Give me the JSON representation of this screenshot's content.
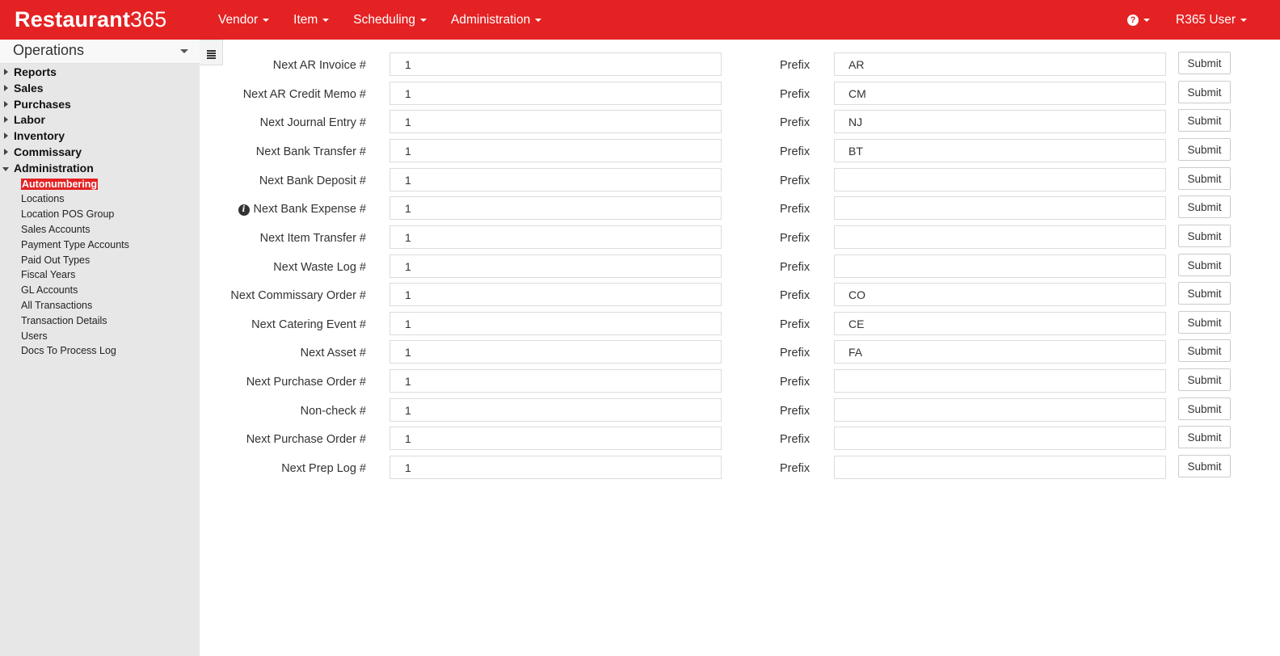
{
  "app": {
    "logo_bold": "Restaurant",
    "logo_thin": "365"
  },
  "nav": {
    "items": [
      {
        "label": "Vendor"
      },
      {
        "label": "Item"
      },
      {
        "label": "Scheduling"
      },
      {
        "label": "Administration"
      }
    ],
    "help_icon": "question-circle-icon",
    "user_label": "R365 User"
  },
  "colors": {
    "brand": "#e42223",
    "sidebar_bg": "#e7e7e7"
  },
  "sidebar": {
    "title": "Operations",
    "groups": [
      {
        "label": "Reports",
        "expanded": false
      },
      {
        "label": "Sales",
        "expanded": false
      },
      {
        "label": "Purchases",
        "expanded": false
      },
      {
        "label": "Labor",
        "expanded": false
      },
      {
        "label": "Inventory",
        "expanded": false
      },
      {
        "label": "Commissary",
        "expanded": false
      },
      {
        "label": "Administration",
        "expanded": true
      }
    ],
    "admin_items": [
      {
        "label": "Autonumbering",
        "active": true
      },
      {
        "label": "Locations"
      },
      {
        "label": "Location POS Group"
      },
      {
        "label": "Sales Accounts"
      },
      {
        "label": "Payment Type Accounts"
      },
      {
        "label": "Paid Out Types"
      },
      {
        "label": "Fiscal Years"
      },
      {
        "label": "GL Accounts"
      },
      {
        "label": "All Transactions"
      },
      {
        "label": "Transaction Details"
      },
      {
        "label": "Users"
      },
      {
        "label": "Docs To Process Log"
      }
    ]
  },
  "form": {
    "prefix_label": "Prefix",
    "submit_label": "Submit",
    "rows": [
      {
        "label": "Next AR Invoice #",
        "value": "1",
        "prefix": "AR"
      },
      {
        "label": "Next AR Credit Memo #",
        "value": "1",
        "prefix": "CM"
      },
      {
        "label": "Next Journal Entry #",
        "value": "1",
        "prefix": "NJ"
      },
      {
        "label": "Next Bank Transfer #",
        "value": "1",
        "prefix": "BT"
      },
      {
        "label": "Next Bank Deposit #",
        "value": "1",
        "prefix": ""
      },
      {
        "label": "Next Bank Expense #",
        "value": "1",
        "prefix": "",
        "info": true
      },
      {
        "label": "Next Item Transfer #",
        "value": "1",
        "prefix": ""
      },
      {
        "label": "Next Waste Log #",
        "value": "1",
        "prefix": ""
      },
      {
        "label": "Next Commissary Order #",
        "value": "1",
        "prefix": "CO"
      },
      {
        "label": "Next Catering Event #",
        "value": "1",
        "prefix": "CE"
      },
      {
        "label": "Next Asset #",
        "value": "1",
        "prefix": "FA"
      },
      {
        "label": "Next Purchase Order #",
        "value": "1",
        "prefix": ""
      },
      {
        "label": "Non-check #",
        "value": "1",
        "prefix": ""
      },
      {
        "label": "Next Purchase Order #",
        "value": "1",
        "prefix": ""
      },
      {
        "label": "Next Prep Log #",
        "value": "1",
        "prefix": ""
      }
    ]
  }
}
